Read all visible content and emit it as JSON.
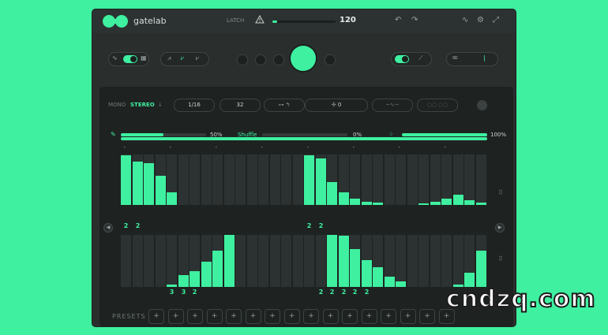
{
  "app": {
    "name": "gatelab",
    "cpu_label": "LATCH"
  },
  "tempo": {
    "value": "120",
    "fill": 0.08
  },
  "controls": {
    "mono": "MONO",
    "stereo": "STEREO",
    "stereo_arrow": "↓",
    "rate": "1/16",
    "steps": "32",
    "offset": "0",
    "mix_pct": "50%",
    "shuffle": "Shuffle",
    "shuffle_pct": "0%",
    "depth_pct": "100%"
  },
  "slider_levels": {
    "mix": 0.5,
    "shuffle": 0.0,
    "depth": 1.0
  },
  "colors": {
    "accent": "#3ef0a0",
    "panel": "#2a2f2e",
    "background": "#3ef0a0"
  },
  "grid_top": {
    "numbers": [
      "2",
      "2",
      "",
      "",
      "",
      "",
      "",
      "",
      "",
      "",
      "",
      "",
      "",
      "",
      "",
      "",
      "2",
      "2",
      "",
      "",
      "",
      "",
      "",
      "",
      "",
      "",
      "",
      "",
      "",
      "",
      "",
      ""
    ],
    "levels": [
      0.98,
      0.86,
      0.83,
      0.58,
      0.25,
      0,
      0,
      0,
      0,
      0,
      0,
      0,
      0,
      0,
      0,
      0,
      0.98,
      0.92,
      0.45,
      0.25,
      0.12,
      0.07,
      0.04,
      0,
      0,
      0,
      0.03,
      0.06,
      0.12,
      0.2,
      0.1,
      0.05
    ]
  },
  "grid_bottom": {
    "numbers": [
      "",
      "",
      "",
      "",
      "3",
      "3",
      "2",
      "",
      "",
      "",
      "",
      "",
      "",
      "",
      "",
      "",
      "",
      "2",
      "2",
      "2",
      "2",
      "2",
      "",
      "",
      "",
      "",
      "",
      "",
      "",
      "",
      "",
      ""
    ],
    "levels": [
      0,
      0,
      0,
      0,
      0.04,
      0.22,
      0.3,
      0.48,
      0.7,
      1.0,
      0,
      0,
      0,
      0,
      0,
      0,
      0,
      0,
      1.0,
      0.98,
      0.72,
      0.52,
      0.38,
      0.2,
      0.1,
      0,
      0,
      0,
      0,
      0.05,
      0.28,
      0.7,
      1.0
    ],
    "levels_note": ""
  },
  "presets": {
    "label": "PRESETS",
    "add_symbol": "+"
  },
  "watermark": "cndzq.com",
  "icons": [
    "gatelab-logo-icon",
    "warning-icon",
    "undo-icon",
    "redo-icon",
    "curve-icon",
    "gear-icon",
    "expand-icon",
    "wave-icon",
    "arrow-left-icon",
    "arrow-right-icon",
    "infinity-icon",
    "drag-handle-icon",
    "pen-icon",
    "dice-icon",
    "play-icon"
  ]
}
